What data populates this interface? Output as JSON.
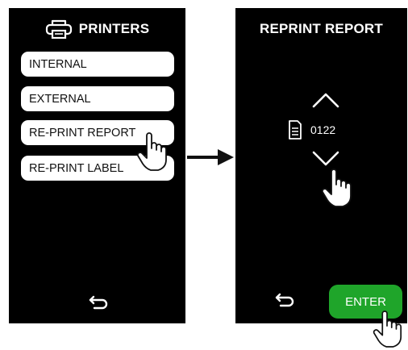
{
  "left_screen": {
    "title": "PRINTERS",
    "menu": [
      {
        "label": "INTERNAL"
      },
      {
        "label": "EXTERNAL"
      },
      {
        "label": "RE-PRINT REPORT"
      },
      {
        "label": "RE-PRINT LABEL"
      }
    ],
    "icons": {
      "header": "printer-icon",
      "footer": "back-icon",
      "pointer": "hand-pointer-icon"
    }
  },
  "right_screen": {
    "title": "REPRINT REPORT",
    "report_number": "0122",
    "enter_label": "ENTER",
    "icons": {
      "up": "chevron-up-icon",
      "down": "chevron-down-icon",
      "document": "document-icon",
      "footer": "back-icon",
      "pointer": "hand-pointer-icon"
    },
    "enter_color": "#1fa52a"
  },
  "flow": {
    "connector": "arrow-right-icon"
  }
}
